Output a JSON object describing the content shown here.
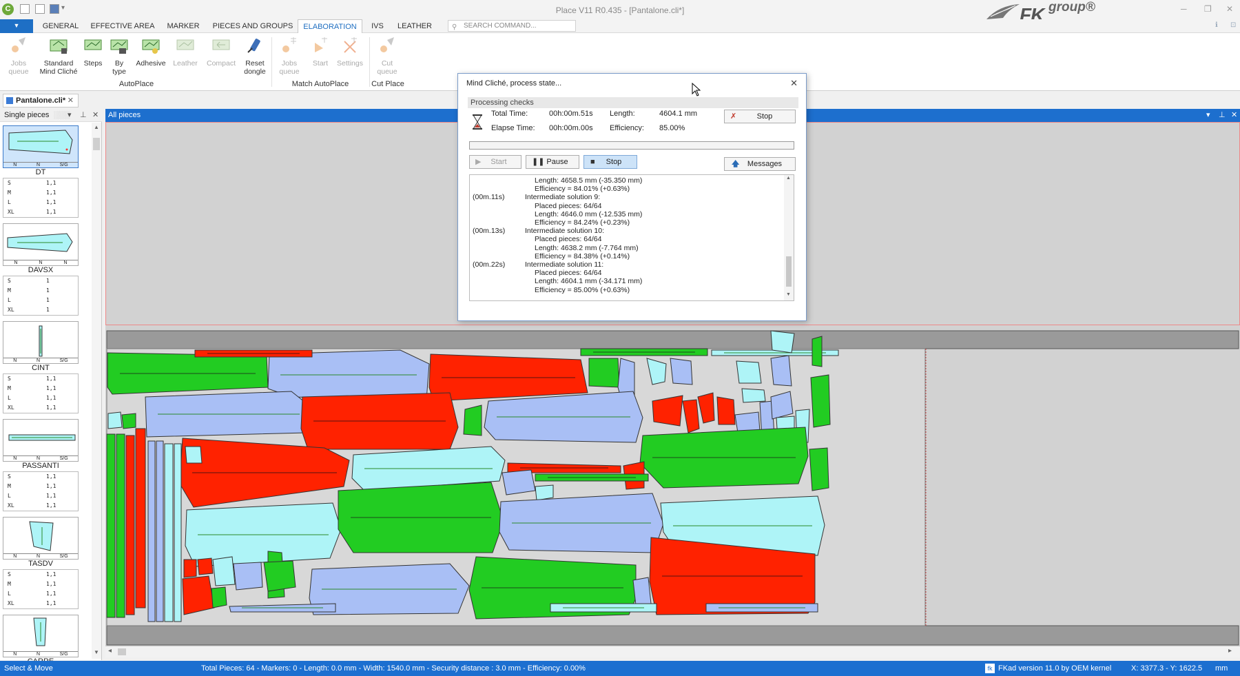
{
  "window": {
    "title": "Place V11 R0.435 - [Pantalone.cli*]",
    "brand": "FK",
    "brand_suffix": "group®"
  },
  "menu": {
    "tabs": [
      "GENERAL",
      "EFFECTIVE AREA",
      "MARKER",
      "PIECES AND GROUPS",
      "ELABORATION",
      "IVS",
      "LEATHER"
    ],
    "active_tab": "ELABORATION",
    "search_placeholder": "SEARCH COMMAND..."
  },
  "ribbon": {
    "buttons": [
      {
        "label": "Jobs\nqueue",
        "enabled": false
      },
      {
        "label": "Standard\nMind Cliché",
        "enabled": true
      },
      {
        "label": "Steps",
        "enabled": true
      },
      {
        "label": "By\ntype",
        "enabled": true
      },
      {
        "label": "Adhesive",
        "enabled": true
      },
      {
        "label": "Leather",
        "enabled": false
      },
      {
        "label": "Compact",
        "enabled": false
      },
      {
        "label": "Reset\ndongle",
        "enabled": true
      },
      {
        "label": "Jobs\nqueue",
        "enabled": false
      },
      {
        "label": "Start",
        "enabled": false
      },
      {
        "label": "Settings",
        "enabled": false
      },
      {
        "label": "Cut\nqueue",
        "enabled": false
      }
    ],
    "groups": [
      "AutoPlace",
      "Match AutoPlace",
      "Cut Place"
    ]
  },
  "document_tab": "Pantalone.cli*",
  "left_panel": {
    "title": "Single pieces",
    "pieces": [
      {
        "name": "DT",
        "foot": [
          "N",
          "N",
          "S/G"
        ],
        "sizes": [
          [
            "S",
            "1,1"
          ],
          [
            "M",
            "1,1"
          ],
          [
            "L",
            "1,1"
          ],
          [
            "XL",
            "1,1"
          ]
        ]
      },
      {
        "name": "DAVSX",
        "foot": [
          "N",
          "N",
          "N"
        ],
        "sizes": [
          [
            "S",
            "1"
          ],
          [
            "M",
            "1"
          ],
          [
            "L",
            "1"
          ],
          [
            "XL",
            "1"
          ]
        ]
      },
      {
        "name": "CINT",
        "foot": [
          "N",
          "N",
          "S/G"
        ],
        "sizes": [
          [
            "S",
            "1,1"
          ],
          [
            "M",
            "1,1"
          ],
          [
            "L",
            "1,1"
          ],
          [
            "XL",
            "1,1"
          ]
        ]
      },
      {
        "name": "PASSANTI",
        "foot": [
          "N",
          "N",
          "S/G"
        ],
        "sizes": [
          [
            "S",
            "1,1"
          ],
          [
            "M",
            "1,1"
          ],
          [
            "L",
            "1,1"
          ],
          [
            "XL",
            "1,1"
          ]
        ]
      },
      {
        "name": "TASDV",
        "foot": [
          "N",
          "N",
          "S/G"
        ],
        "sizes": [
          [
            "S",
            "1,1"
          ],
          [
            "M",
            "1,1"
          ],
          [
            "L",
            "1,1"
          ],
          [
            "XL",
            "1,1"
          ]
        ]
      },
      {
        "name": "CARRE",
        "foot": [
          "N",
          "N",
          "S/G"
        ],
        "sizes": []
      }
    ]
  },
  "main_view": {
    "title": "All pieces"
  },
  "dialog": {
    "title": "Mind Cliché, process state...",
    "section": "Processing checks",
    "total_time_label": "Total Time:",
    "total_time": "00h:00m.51s",
    "elapse_time_label": "Elapse Time:",
    "elapse_time": "00h:00m.00s",
    "length_label": "Length:",
    "length": "4604.1 mm",
    "efficiency_label": "Efficiency:",
    "efficiency": "85.00%",
    "stop_label": "Stop",
    "start_label": "Start",
    "pause_label": "Pause",
    "stop2_label": "Stop",
    "messages_label": "Messages",
    "log": [
      {
        "t": "",
        "indent": 2,
        "text": "Length: 4658.5 mm (-35.350 mm)"
      },
      {
        "t": "",
        "indent": 2,
        "text": "Efficiency = 84.01% (+0.63%)"
      },
      {
        "t": "(00m.11s)",
        "indent": 1,
        "text": "Intermediate solution 9:"
      },
      {
        "t": "",
        "indent": 2,
        "text": "Placed pieces: 64/64"
      },
      {
        "t": "",
        "indent": 2,
        "text": "Length: 4646.0 mm (-12.535 mm)"
      },
      {
        "t": "",
        "indent": 2,
        "text": "Efficiency = 84.24% (+0.23%)"
      },
      {
        "t": "(00m.13s)",
        "indent": 1,
        "text": "Intermediate solution 10:"
      },
      {
        "t": "",
        "indent": 2,
        "text": "Placed pieces: 64/64"
      },
      {
        "t": "",
        "indent": 2,
        "text": "Length: 4638.2 mm (-7.764 mm)"
      },
      {
        "t": "",
        "indent": 2,
        "text": "Efficiency = 84.38% (+0.14%)"
      },
      {
        "t": "(00m.22s)",
        "indent": 1,
        "text": "Intermediate solution 11:"
      },
      {
        "t": "",
        "indent": 2,
        "text": "Placed pieces: 64/64"
      },
      {
        "t": "",
        "indent": 2,
        "text": "Length: 4604.1 mm (-34.171 mm)"
      },
      {
        "t": "",
        "indent": 2,
        "text": "Efficiency = 85.00% (+0.63%)"
      }
    ]
  },
  "status": {
    "mode": "Select & Move",
    "summary": "Total Pieces: 64 - Markers: 0 - Length: 0.0 mm - Width: 1540.0 mm - Security distance : 3.0 mm - Efficiency: 0.00%",
    "version": "FKad version 11.0 by OEM kernel",
    "coords": "X: 3377.3 - Y: 1622.5",
    "unit": "mm"
  },
  "colors": {
    "accent": "#1d6fce",
    "piece_green": "#22cc22",
    "piece_red": "#ff2200",
    "piece_blue": "#a9bff5",
    "piece_cyan": "#aef4f7"
  }
}
